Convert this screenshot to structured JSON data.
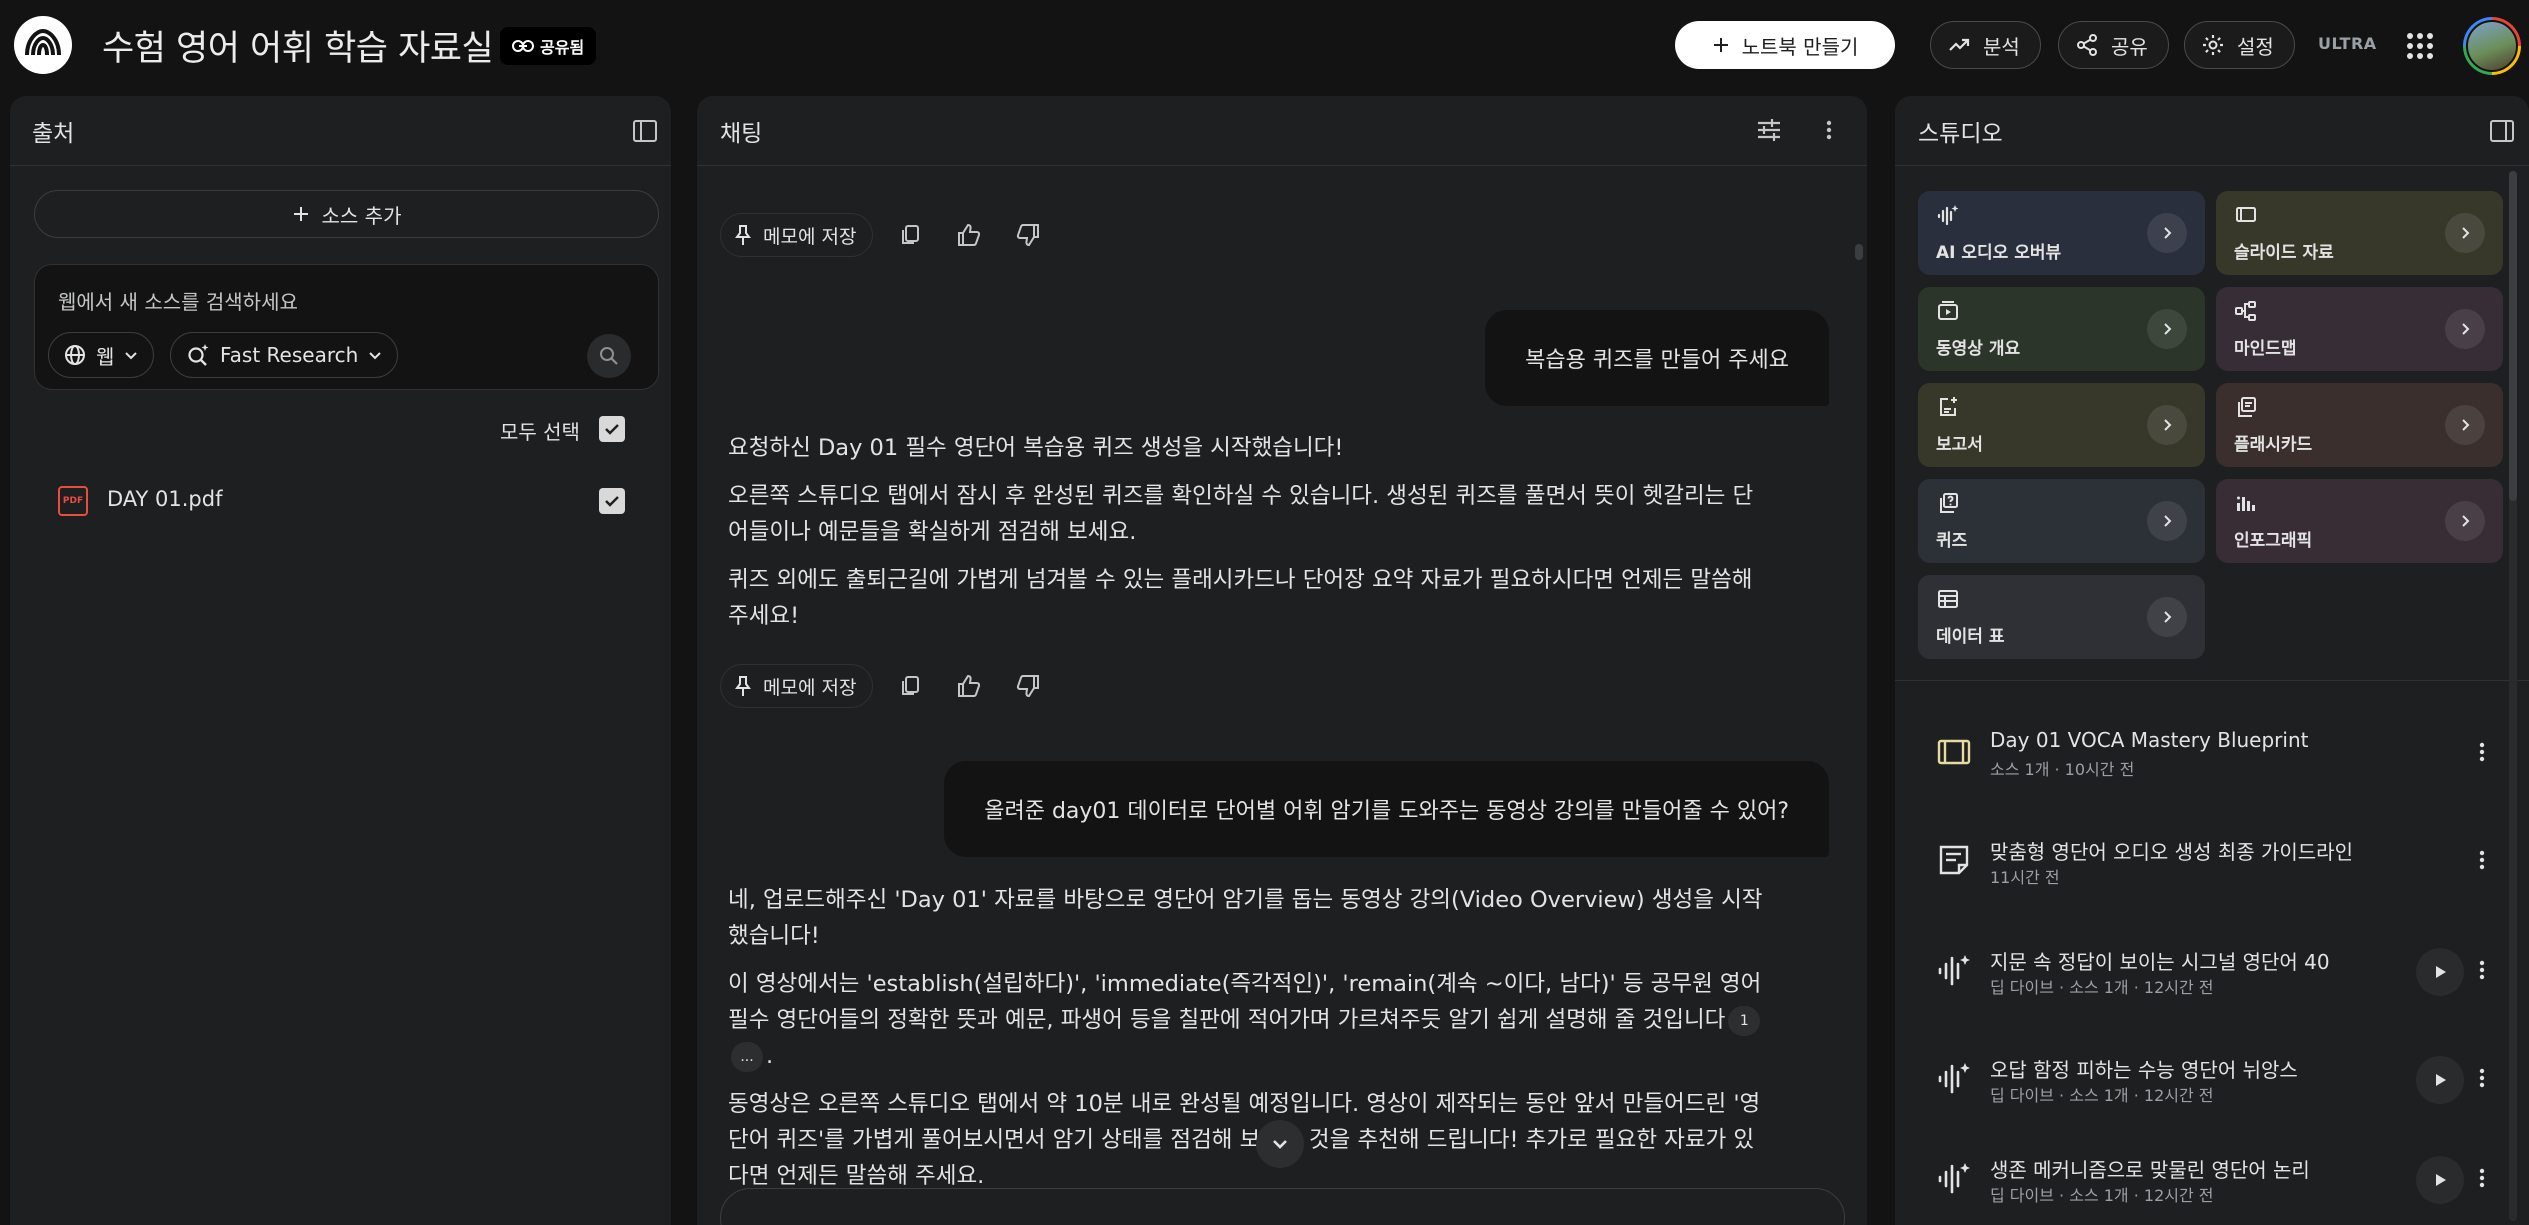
{
  "header": {
    "title": "수험 영어 어휘 학습 자료실",
    "shared_badge": "공유됨",
    "new_notebook": "노트북 만들기",
    "analytics": "분석",
    "share": "공유",
    "settings": "설정",
    "plan": "ULTRA"
  },
  "sources": {
    "title": "출처",
    "add_source": "소스 추가",
    "search_placeholder": "웹에서 새 소스를 검색하세요",
    "web_chip": "웹",
    "research_chip": "Fast Research",
    "select_all": "모두 선택",
    "files": [
      {
        "name": "DAY 01.pdf",
        "type_label": "PDF"
      }
    ]
  },
  "chat": {
    "title": "채팅",
    "save_to_note": "메모에 저장",
    "messages": {
      "user1": "복습용 퀴즈를 만들어 주세요",
      "reply1": [
        "요청하신 Day 01 필수 영단어 복습용 퀴즈 생성을 시작했습니다!",
        "오른쪽 스튜디오 탭에서 잠시 후 완성된 퀴즈를 확인하실 수 있습니다. 생성된 퀴즈를 풀면서 뜻이 헷갈리는 단어들이나 예문들을 확실하게 점검해 보세요.",
        "퀴즈 외에도 출퇴근길에 가볍게 넘겨볼 수 있는 플래시카드나 단어장 요약 자료가 필요하시다면 언제든 말씀해 주세요!"
      ],
      "user2": "올려준 day01 데이터로 단어별 어휘 암기를 도와주는 동영상 강의를 만들어줄 수 있어?",
      "reply2": {
        "p1": "네, 업로드해주신 'Day 01' 자료를 바탕으로 영단어 암기를 돕는 동영상 강의(Video Overview) 생성을 시작했습니다!",
        "p2": "이 영상에서는 'establish(설립하다)', 'immediate(즉각적인)', 'remain(계속 ~이다, 남다)' 등 공무원 영어 필수 영단어들의 정확한 뜻과 예문, 파생어 등을 칠판에 적어가며 가르쳐주듯 알기 쉽게 설명해 줄 것입니다",
        "cite1": "1",
        "cite2": "...",
        "p3_end": ".",
        "p4": "동영상은 오른쪽 스튜디오 탭에서 약 10분 내로 완성될 예정입니다. 영상이 제작되는 동안 앞서 만들어드린 '영단어 퀴즈'를 가볍게 풀어보시면서 암기 상태를 점검해 보시는 것을 추천해 드립니다! 추가로 필요한 자료가 있다면 언제든 말씀해 주세요."
      }
    }
  },
  "studio": {
    "title": "스튜디오",
    "tiles": [
      {
        "label": "AI 오디오 오버뷰",
        "icon": "audio-wave-icon",
        "color": "#2a2f3d"
      },
      {
        "label": "슬라이드 자료",
        "icon": "slides-icon",
        "color": "#38382a"
      },
      {
        "label": "동영상 개요",
        "icon": "video-icon",
        "color": "#2b3529"
      },
      {
        "label": "마인드맵",
        "icon": "mindmap-icon",
        "color": "#372d37"
      },
      {
        "label": "보고서",
        "icon": "report-icon",
        "color": "#37372a"
      },
      {
        "label": "플래시카드",
        "icon": "flashcard-icon",
        "color": "#3a2f2d"
      },
      {
        "label": "퀴즈",
        "icon": "quiz-icon",
        "color": "#2c3037"
      },
      {
        "label": "인포그래픽",
        "icon": "infographic-icon",
        "color": "#382d35"
      },
      {
        "label": "데이터 표",
        "icon": "table-icon",
        "color": "#2f3036"
      }
    ],
    "artifacts": [
      {
        "title": "Day 01 VOCA Mastery Blueprint",
        "meta": "소스 1개 · 10시간 전",
        "icon": "slides-icon",
        "playable": false
      },
      {
        "title": "맞춤형 영단어 오디오 생성 최종 가이드라인",
        "meta": "11시간 전",
        "icon": "note-icon",
        "playable": false
      },
      {
        "title": "지문 속 정답이 보이는 시그널 영단어 40",
        "meta": "딥 다이브 · 소스 1개 · 12시간 전",
        "icon": "audio-wave-icon",
        "playable": true
      },
      {
        "title": "오답 함정 피하는 수능 영단어 뉘앙스",
        "meta": "딥 다이브 · 소스 1개 · 12시간 전",
        "icon": "audio-wave-icon",
        "playable": true
      },
      {
        "title": "생존 메커니즘으로 맞물린 영단어 논리",
        "meta": "딥 다이브 · 소스 1개 · 12시간 전",
        "icon": "audio-wave-icon",
        "playable": true
      }
    ]
  }
}
